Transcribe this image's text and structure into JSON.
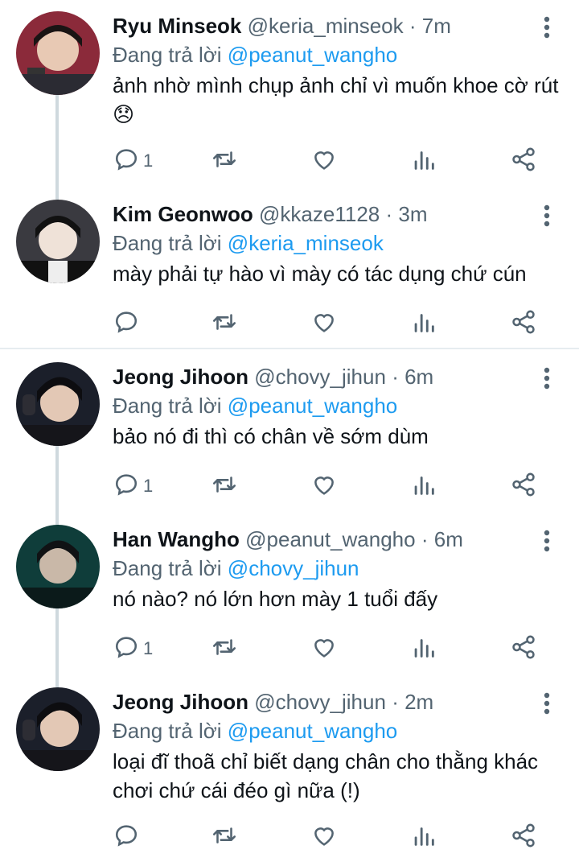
{
  "tweets": [
    {
      "name": "Ryu Minseok",
      "handle": "@keria_minseok",
      "dot": "·",
      "time": "7m",
      "replying_prefix": "Đang trả lời",
      "replying_to": "@peanut_wangho",
      "text": "ảnh nhờ mình chụp ảnh chỉ vì muốn khoe cờ rút 😞",
      "reply_count": "1",
      "avatar_color": "#8b2a3a"
    },
    {
      "name": "Kim Geonwoo",
      "handle": "@kkaze1128",
      "dot": "·",
      "time": "3m",
      "replying_prefix": "Đang trả lời",
      "replying_to": "@keria_minseok",
      "text": "mày phải tự hào vì mày có tác dụng chứ cún",
      "reply_count": "",
      "avatar_color": "#2a2a2e"
    },
    {
      "name": "Jeong Jihoon",
      "handle": "@chovy_jihun",
      "dot": "·",
      "time": "6m",
      "replying_prefix": "Đang trả lời",
      "replying_to": "@peanut_wangho",
      "text": "bảo nó đi thì có chân về sớm dùm",
      "reply_count": "1",
      "avatar_color": "#1b1f2a"
    },
    {
      "name": "Han Wangho",
      "handle": "@peanut_wangho",
      "dot": "·",
      "time": "6m",
      "replying_prefix": "Đang trả lời",
      "replying_to": "@chovy_jihun",
      "text": "nó nào? nó lớn hơn mày 1 tuổi đấy",
      "reply_count": "1",
      "avatar_color": "#0f3d3a"
    },
    {
      "name": "Jeong Jihoon",
      "handle": "@chovy_jihun",
      "dot": "·",
      "time": "2m",
      "replying_prefix": "Đang trả lời",
      "replying_to": "@peanut_wangho",
      "text": "loại đĩ thoã chỉ biết dạng chân cho thằng khác chơi chứ cái đéo gì nữa (!)",
      "reply_count": "",
      "avatar_color": "#1b1f2a"
    }
  ],
  "colors": {
    "accent": "#1d9bf0",
    "secondary_text": "#536471",
    "thread_line": "#cfd9de"
  },
  "icons": [
    "reply-icon",
    "retweet-icon",
    "like-icon",
    "stats-icon",
    "share-icon",
    "more-icon"
  ]
}
